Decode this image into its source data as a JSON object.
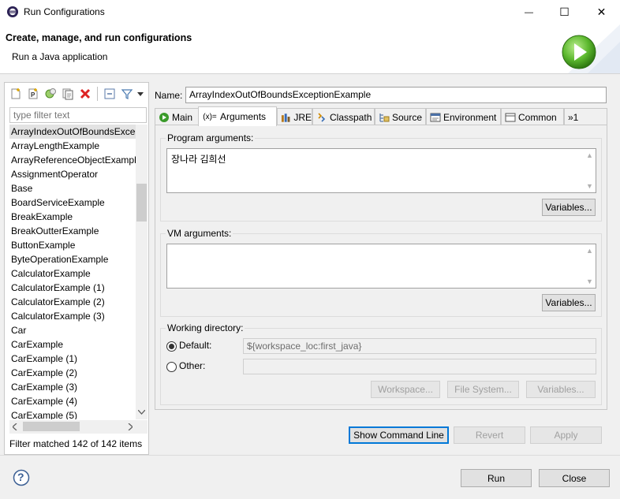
{
  "window": {
    "title": "Run Configurations",
    "controls": {
      "minimize": "—",
      "maximize": "☐",
      "close": "✕"
    }
  },
  "header": {
    "title": "Create, manage, and run configurations",
    "subtitle": "Run a Java application"
  },
  "left": {
    "toolbar_icons": [
      "new-config-icon",
      "new-prototype-icon",
      "export-icon",
      "duplicate-icon",
      "delete-icon",
      "collapse-all-icon",
      "filter-icon",
      "view-menu-icon"
    ],
    "filter_placeholder": "type filter text",
    "items": [
      "ArrayIndexOutOfBoundsException",
      "ArrayLengthExample",
      "ArrayReferenceObjectExample",
      "AssignmentOperator",
      "Base",
      "BoardServiceExample",
      "BreakExample",
      "BreakOutterExample",
      "ButtonExample",
      "ByteOperationExample",
      "CalculatorExample",
      "CalculatorExample (1)",
      "CalculatorExample (2)",
      "CalculatorExample (3)",
      "Car",
      "CarExample",
      "CarExample (1)",
      "CarExample (2)",
      "CarExample (3)",
      "CarExample (4)",
      "CarExample (5)"
    ],
    "selected_index": 0,
    "status": "Filter matched 142 of 142 items"
  },
  "config": {
    "name_label": "Name:",
    "name_value": "ArrayIndexOutOfBoundsExceptionExample",
    "tabs": [
      {
        "label": "Main",
        "icon": "main-tab-icon"
      },
      {
        "label": "Arguments",
        "icon": "arguments-tab-icon"
      },
      {
        "label": "JRE",
        "icon": "jre-tab-icon"
      },
      {
        "label": "Classpath",
        "icon": "classpath-tab-icon"
      },
      {
        "label": "Source",
        "icon": "source-tab-icon"
      },
      {
        "label": "Environment",
        "icon": "environment-tab-icon"
      },
      {
        "label": "Common",
        "icon": "common-tab-icon"
      }
    ],
    "tabs_overflow": "»1",
    "active_tab": "Arguments",
    "arguments_icon_text": "(x)=",
    "program_args_label": "Program arguments:",
    "program_args_value": "장나라 김희선",
    "vm_args_label": "VM arguments:",
    "vm_args_value": "",
    "variables_label": "Variables...",
    "working_dir_label": "Working directory:",
    "default_label": "Default:",
    "default_value": "${workspace_loc:first_java}",
    "other_label": "Other:",
    "other_value": "",
    "workspace_label": "Workspace...",
    "filesystem_label": "File System...",
    "variables_wd_label": "Variables..."
  },
  "bottom": {
    "show_cmd_label": "Show Command Line",
    "revert_label": "Revert",
    "apply_label": "Apply",
    "run_label": "Run",
    "close_label": "Close",
    "help_glyph": "?"
  }
}
